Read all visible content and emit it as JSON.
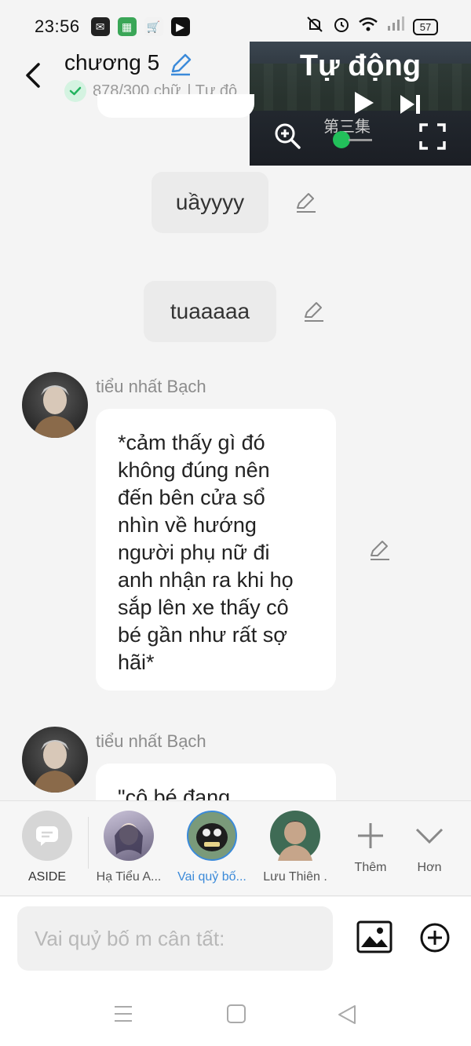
{
  "status": {
    "time": "23:56",
    "battery": "57"
  },
  "header": {
    "title": "chương 5",
    "word_count": "878/300 chữ",
    "mode_text": "| Tự độ"
  },
  "video": {
    "title": "Tự động",
    "subtitle": "第三集"
  },
  "messages": [
    {
      "text": "uầyyyy"
    },
    {
      "text": "tuaaaaa"
    }
  ],
  "story": [
    {
      "sender": "tiểu nhất Bạch",
      "lines": [
        "*cảm thấy gì đó",
        "không đúng nên",
        "đến bên cửa sổ",
        "nhìn về hướng",
        "người phụ nữ đi",
        "anh nhận ra khi họ",
        "sắp lên xe thấy cô",
        "bé gần như rất sợ",
        "hãi*"
      ]
    },
    {
      "sender": "tiểu nhất Bạch",
      "lines": [
        "\"cô bé đang"
      ]
    }
  ],
  "characters": [
    {
      "label": "ASIDE"
    },
    {
      "label": "Hạ Tiểu A..."
    },
    {
      "label": "Vai quỷ bố..."
    },
    {
      "label": "Lưu Thiên ."
    },
    {
      "label": "Thêm"
    },
    {
      "label": "Hơn"
    }
  ],
  "input": {
    "placeholder": "Vai quỷ bố m cân tất:"
  },
  "colors": {
    "accent_blue": "#3b8ad9",
    "check_green": "#22b35e"
  }
}
